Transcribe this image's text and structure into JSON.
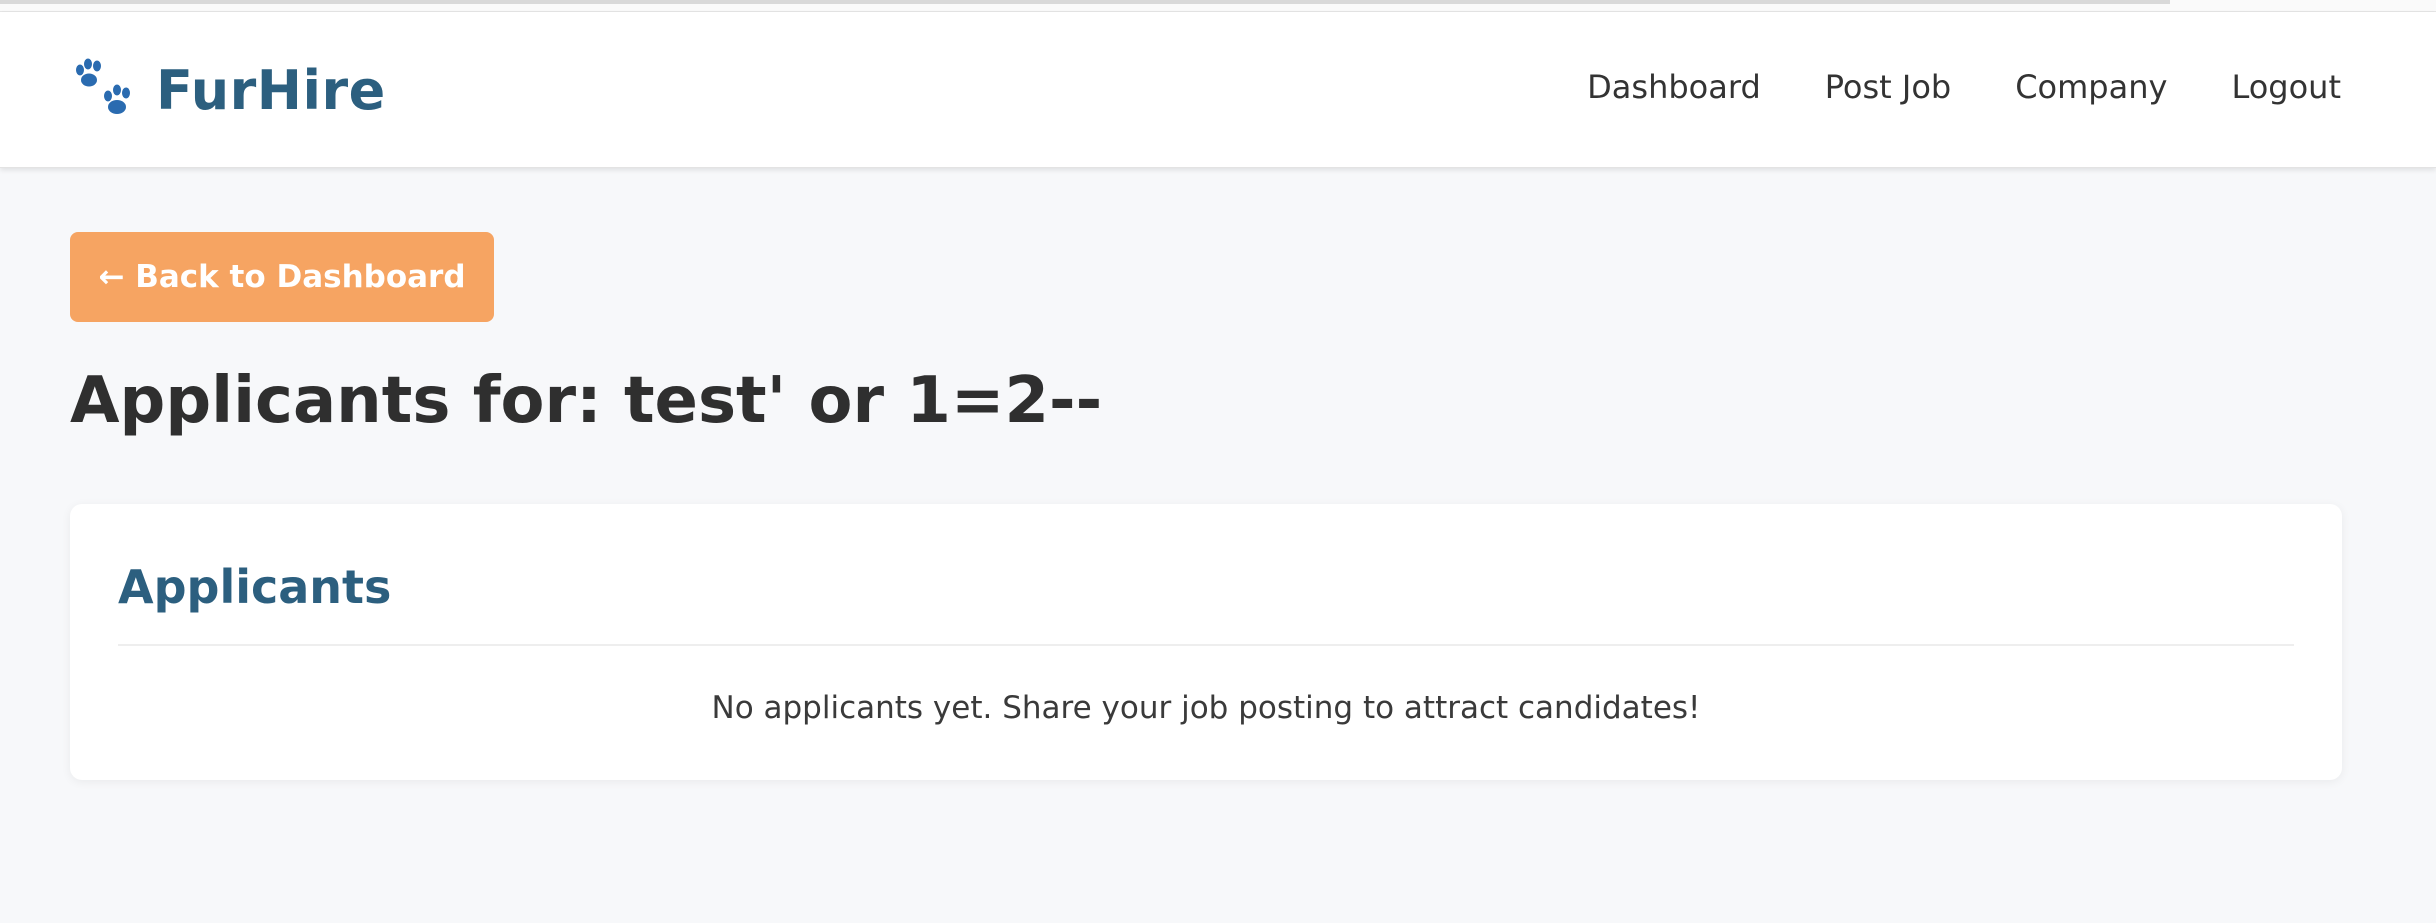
{
  "brand": {
    "name": "FurHire",
    "icon": "paw-icon",
    "color": "#2c5f7f"
  },
  "nav": {
    "items": [
      {
        "label": "Dashboard"
      },
      {
        "label": "Post Job"
      },
      {
        "label": "Company"
      },
      {
        "label": "Logout"
      }
    ]
  },
  "back_button": {
    "label": "← Back to Dashboard",
    "color": "#f6a462"
  },
  "page": {
    "title": "Applicants for: test' or 1=2--"
  },
  "applicants_card": {
    "title": "Applicants",
    "empty_message": "No applicants yet. Share your job posting to attract candidates!"
  }
}
